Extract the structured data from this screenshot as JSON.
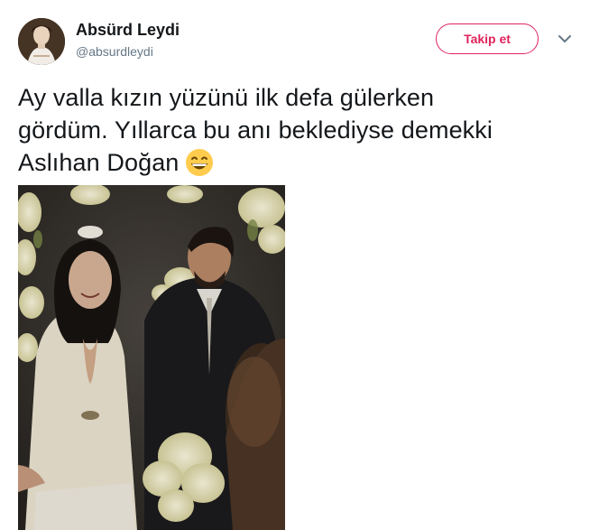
{
  "tweet": {
    "author_name": "Absürd Leydi",
    "author_handle": "@absurdleydi",
    "follow_label": "Takip et",
    "text_line1": "Ay valla kızın yüzünü ilk defa gülerken",
    "text_line2": "gördüm. Yıllarca bu anı beklediyse demekki",
    "text_line3": "Aslıhan Doğan",
    "emoji": "grinning-face-with-smiling-eyes",
    "accent_color": "#e0245e"
  },
  "icons": {
    "more": "chevron-down-icon",
    "avatar": "avatar-portrait"
  }
}
